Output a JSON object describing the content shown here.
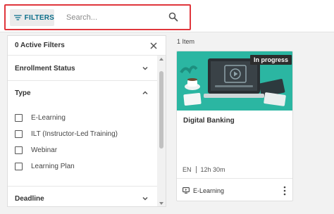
{
  "toolbar": {
    "filters_label": "FILTERS",
    "search_placeholder": "Search..."
  },
  "filters_panel": {
    "title": "0 Active Filters",
    "sections": {
      "enrollment": "Enrollment Status",
      "type": "Type",
      "deadline": "Deadline"
    },
    "type_options": [
      {
        "label": "E-Learning",
        "checked": false
      },
      {
        "label": "ILT (Instructor-Led Training)",
        "checked": false
      },
      {
        "label": "Webinar",
        "checked": false
      },
      {
        "label": "Learning Plan",
        "checked": false
      }
    ]
  },
  "results": {
    "count_label": "1 Item"
  },
  "card": {
    "badge": "In progress",
    "title": "Digital Banking",
    "language": "EN",
    "duration": "12h 30m",
    "type": "E-Learning"
  },
  "colors": {
    "accent": "#0a6e8a",
    "highlight": "#e0363c",
    "thumbnail_bg": "#2bb6a2"
  }
}
